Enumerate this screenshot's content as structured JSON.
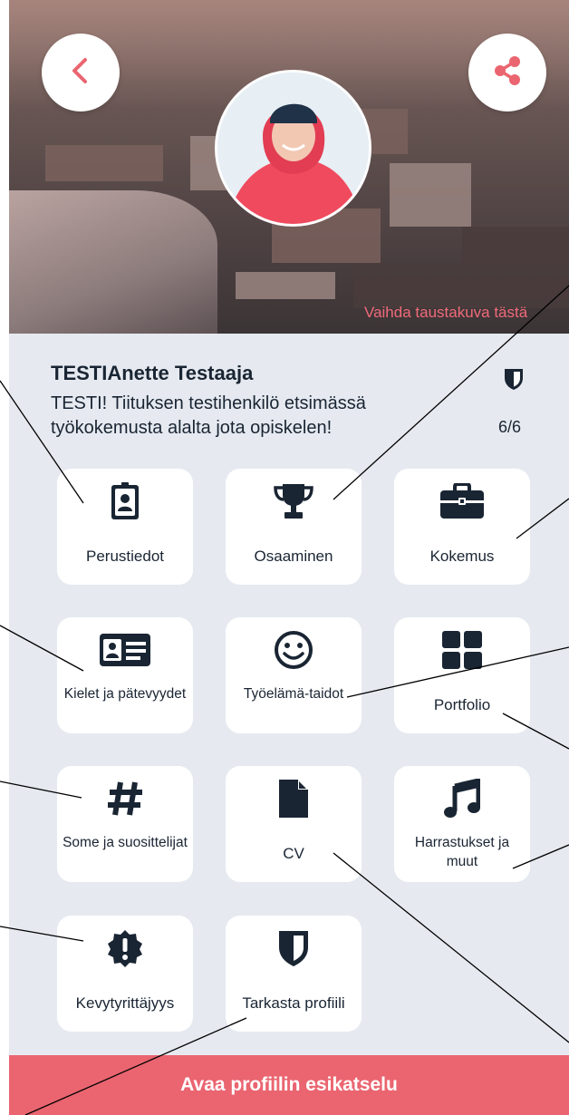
{
  "header": {
    "back_icon": "chevron-left-icon",
    "share_icon": "share-icon",
    "change_background_label": "Vaihda taustakuva tästä"
  },
  "profile": {
    "name": "TESTIAnette Testaaja",
    "bio": "TESTI! Tiituksen testihenkilö etsimässä työkokemusta alalta jota opiskelen!",
    "progress": "6/6",
    "progress_icon": "shield-icon"
  },
  "tiles": [
    {
      "label": "Perustiedot",
      "icon": "id-badge-icon"
    },
    {
      "label": "Osaaminen",
      "icon": "trophy-icon"
    },
    {
      "label": "Kokemus",
      "icon": "briefcase-icon"
    },
    {
      "label": "Kielet ja pätevyydet",
      "icon": "id-card-icon"
    },
    {
      "label": "Työelämä-taidot",
      "icon": "smiley-icon"
    },
    {
      "label": "Portfolio",
      "icon": "grid-icon"
    },
    {
      "label": "Some ja suosittelijat",
      "icon": "hashtag-icon"
    },
    {
      "label": "CV",
      "icon": "document-icon"
    },
    {
      "label": "Harrastukset ja muut",
      "icon": "music-note-icon"
    },
    {
      "label": "Kevytyrittäjyys",
      "icon": "badge-exclamation-icon"
    },
    {
      "label": "Tarkasta profiili",
      "icon": "shield-icon"
    }
  ],
  "footer": {
    "preview_button_label": "Avaa profiilin esikatselu"
  },
  "colors": {
    "accent": "#ea6570",
    "icon_dark": "#1a2533",
    "background": "#e6eaf0",
    "tile": "#ffffff"
  }
}
